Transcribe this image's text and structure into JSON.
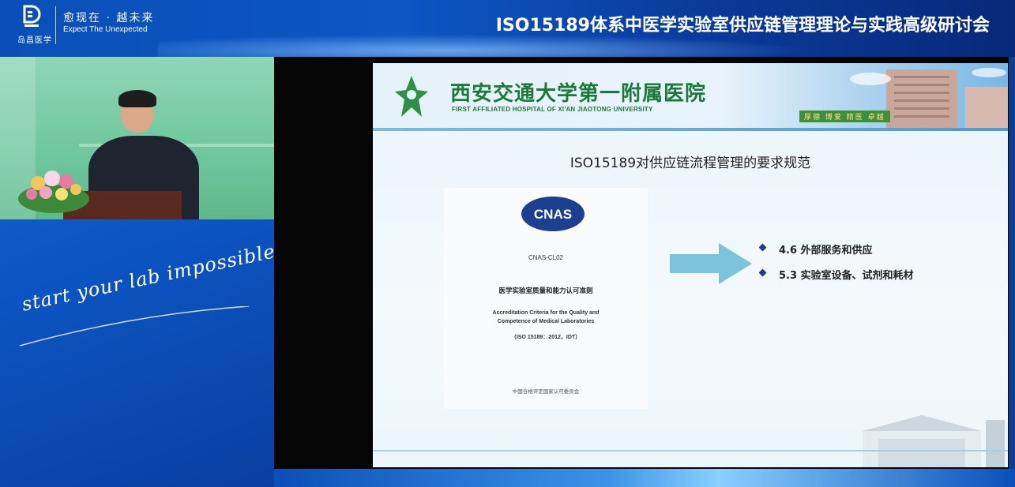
{
  "brand": {
    "logo_text": "岛昌医学",
    "slogan_cn": "愈现在 · 越未来",
    "slogan_en": "Expect The Unexpected"
  },
  "event": {
    "title": "ISO15189体系中医学实验室供应链管理理论与实践高级研讨会"
  },
  "sidebar": {
    "script_slogan": "start your lab impossible"
  },
  "slide": {
    "hospital_name_cn": "西安交通大学第一附属医院",
    "hospital_name_en": "FIRST AFFILIATED HOSPITAL OF XI'AN JIAOTONG UNIVERSITY",
    "hospital_motto": "厚德 博爱 精医 卓越",
    "title": "ISO15189对供应链流程管理的要求规范",
    "document": {
      "logo_text": "CNAS",
      "code": "CNAS-CL02",
      "title_cn": "医学实验室质量和能力认可准则",
      "title_en_1": "Accreditation Criteria for the Quality and",
      "title_en_2": "Competence of Medical Laboratories",
      "title_en_3": "（ISO 15189：2012，IDT）",
      "issuer": "中国合格评定国家认可委员会"
    },
    "requirements": [
      {
        "label": "4.6 外部服务和供应"
      },
      {
        "label": "5.3 实验室设备、试剂和耗材"
      }
    ]
  },
  "colors": {
    "banner_blue": "#0a4fb8",
    "hospital_green": "#1b7a3b",
    "arrow_blue": "#7ec3dd",
    "bullet_navy": "#1d3b86"
  }
}
